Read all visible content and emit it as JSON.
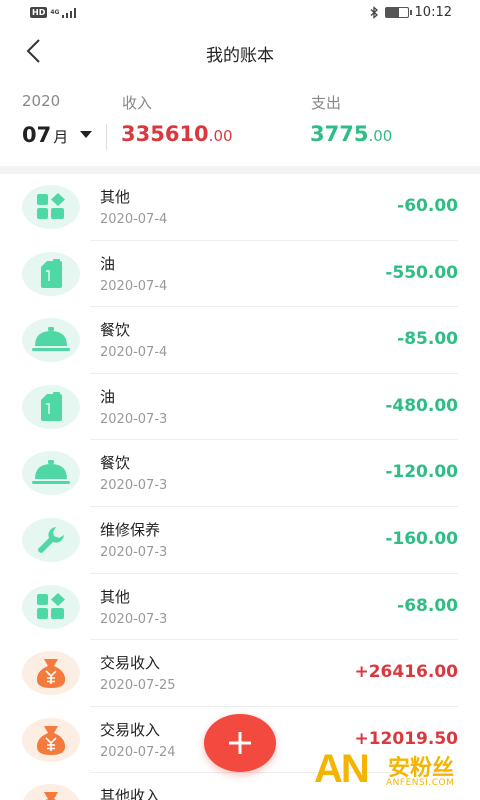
{
  "status_bar": {
    "network_badge": "HD",
    "network_type": "4G",
    "time": "10:12",
    "battery_level": 0.6
  },
  "nav": {
    "title": "我的账本"
  },
  "summary": {
    "year": "2020",
    "month": "07",
    "month_unit": "月",
    "income_label": "收入",
    "income_int": "335610",
    "income_dec": ".00",
    "expense_label": "支出",
    "expense_int": "3775",
    "expense_dec": ".00"
  },
  "colors": {
    "income": "#d9393e",
    "expense": "#2ebd85",
    "fab": "#f24a3e",
    "icon_green": "#4fd8a5",
    "icon_orange": "#f57a3d"
  },
  "records": [
    {
      "title": "其他",
      "date": "2020-07-4",
      "amount": "-60.00",
      "icon": "grid-icon",
      "kind": "out"
    },
    {
      "title": "油",
      "date": "2020-07-4",
      "amount": "-550.00",
      "icon": "fuel-can-icon",
      "kind": "out"
    },
    {
      "title": "餐饮",
      "date": "2020-07-4",
      "amount": "-85.00",
      "icon": "food-cloche-icon",
      "kind": "out"
    },
    {
      "title": "油",
      "date": "2020-07-3",
      "amount": "-480.00",
      "icon": "fuel-can-icon",
      "kind": "out"
    },
    {
      "title": "餐饮",
      "date": "2020-07-3",
      "amount": "-120.00",
      "icon": "food-cloche-icon",
      "kind": "out"
    },
    {
      "title": "维修保养",
      "date": "2020-07-3",
      "amount": "-160.00",
      "icon": "wrench-icon",
      "kind": "out"
    },
    {
      "title": "其他",
      "date": "2020-07-3",
      "amount": "-68.00",
      "icon": "grid-icon",
      "kind": "out"
    },
    {
      "title": "交易收入",
      "date": "2020-07-25",
      "amount": "+26416.00",
      "icon": "money-bag-icon",
      "kind": "in"
    },
    {
      "title": "交易收入",
      "date": "2020-07-24",
      "amount": "+12019.50",
      "icon": "money-bag-icon",
      "kind": "in"
    },
    {
      "title": "其他收入",
      "date": "",
      "amount": "",
      "icon": "money-bag-icon",
      "kind": "in"
    }
  ],
  "fab": {
    "icon": "plus-icon"
  },
  "watermark": {
    "logo": "AN",
    "brand": "安粉丝",
    "url": "ANFENSI.COM"
  }
}
